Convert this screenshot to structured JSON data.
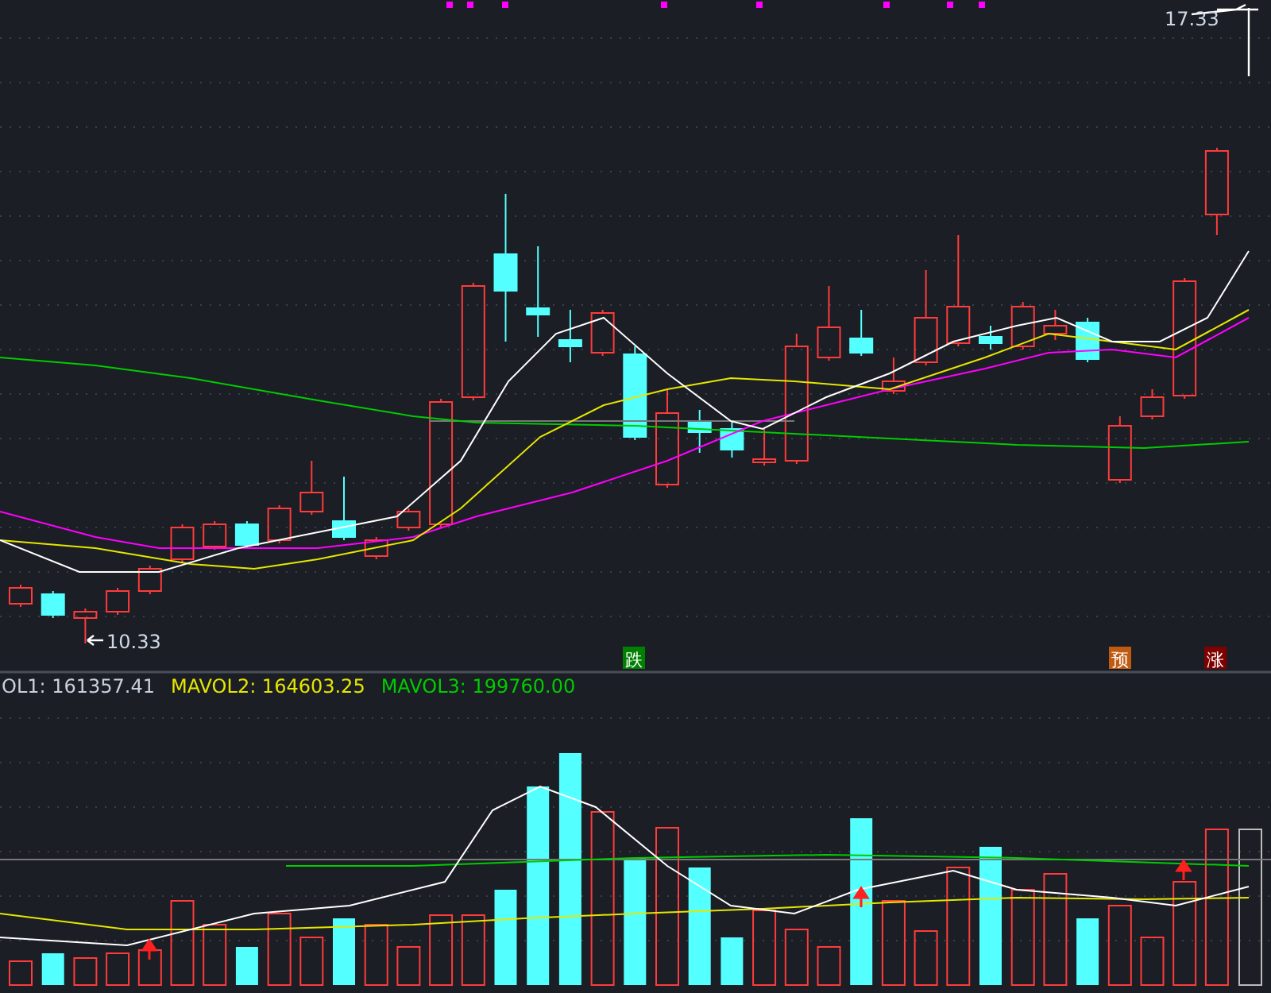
{
  "chart": {
    "high_label": "17.33",
    "low_label": "10.33",
    "signals": [
      {
        "text": "跌",
        "color": "#008000"
      },
      {
        "text": "预",
        "color": "#c05a10"
      },
      {
        "text": "涨",
        "color": "#800000"
      }
    ]
  },
  "volume_panel": {
    "legend": [
      {
        "text": "OL1: 161357.41",
        "color": "#c8d0dc"
      },
      {
        "text": "MAVOL2: 164603.25",
        "color": "#e6e600"
      },
      {
        "text": "MAVOL3: 199760.00",
        "color": "#00cc00"
      }
    ]
  }
}
